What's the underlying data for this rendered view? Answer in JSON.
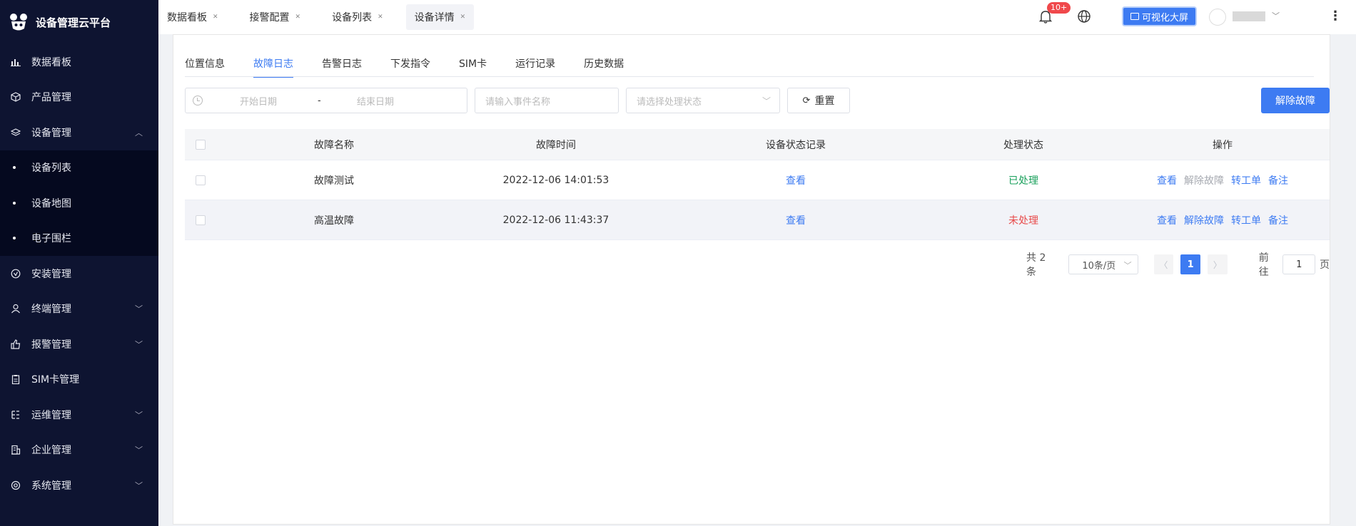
{
  "app": {
    "title": "设备管理云平台"
  },
  "sidebar": {
    "items": [
      {
        "label": "数据看板",
        "icon": "bar-chart-icon"
      },
      {
        "label": "产品管理",
        "icon": "cube-icon"
      },
      {
        "label": "设备管理",
        "icon": "layers-icon",
        "expanded": true
      },
      {
        "label": "安装管理",
        "icon": "check-circle-icon"
      },
      {
        "label": "终端管理",
        "icon": "user-icon"
      },
      {
        "label": "报警管理",
        "icon": "thumb-icon"
      },
      {
        "label": "SIM卡管理",
        "icon": "clipboard-icon"
      },
      {
        "label": "运维管理",
        "icon": "tree-icon"
      },
      {
        "label": "企业管理",
        "icon": "building-icon"
      },
      {
        "label": "系统管理",
        "icon": "gear-icon"
      }
    ],
    "device_sub": [
      "设备列表",
      "设备地图",
      "电子围栏"
    ]
  },
  "topbar": {
    "tabs": [
      "数据看板",
      "接警配置",
      "设备列表",
      "设备详情"
    ],
    "active_tab": "设备详情",
    "badge": "10+",
    "viz_button": "可视化大屏"
  },
  "detail": {
    "tabs": [
      "位置信息",
      "故障日志",
      "告警日志",
      "下发指令",
      "SIM卡",
      "运行记录",
      "历史数据"
    ],
    "active_tab": "故障日志"
  },
  "filters": {
    "start_placeholder": "开始日期",
    "separator": "-",
    "end_placeholder": "结束日期",
    "name_placeholder": "请输入事件名称",
    "status_placeholder": "请选择处理状态",
    "reset_label": "重置",
    "resolve_label": "解除故障"
  },
  "table": {
    "headers": [
      "故障名称",
      "故障时间",
      "设备状态记录",
      "处理状态",
      "操作"
    ],
    "rows": [
      {
        "name": "故障测试",
        "time": "2022-12-06 14:01:53",
        "record": "查看",
        "state": "已处理",
        "state_type": "ok",
        "ops": [
          "查看",
          "解除故障",
          "转工单",
          "备注"
        ]
      },
      {
        "name": "高温故障",
        "time": "2022-12-06 11:43:37",
        "record": "查看",
        "state": "未处理",
        "state_type": "bad",
        "ops": [
          "查看",
          "解除故障",
          "转工单",
          "备注"
        ]
      }
    ]
  },
  "pagination": {
    "total": "共 2 条",
    "page_size": "10条/页",
    "current": "1",
    "goto_prefix": "前往",
    "goto_value": "1",
    "goto_suffix": "页"
  },
  "colors": {
    "primary": "#3d7bf2",
    "sidebar": "#0e1431",
    "ok": "#19a05b",
    "bad": "#e84a4a",
    "badge": "#f0484b"
  }
}
